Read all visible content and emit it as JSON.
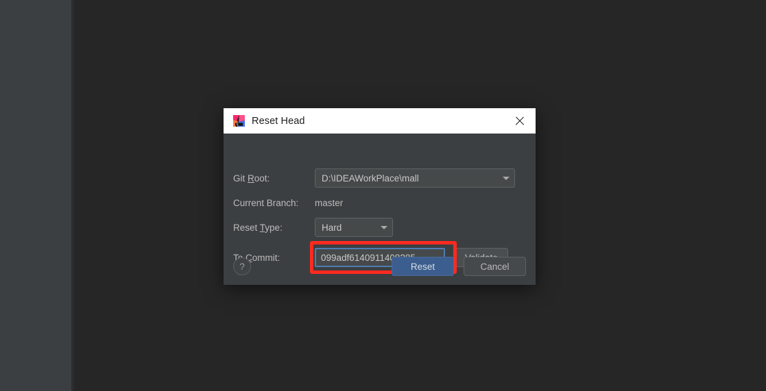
{
  "dialog": {
    "title": "Reset Head",
    "app_icon": "intellij-idea-logo-icon",
    "close_icon": "close-icon",
    "fields": {
      "git_root": {
        "label_before": "Git ",
        "label_mnemonic": "R",
        "label_after": "oot:",
        "value": "D:\\IDEAWorkPlace\\mall",
        "dropdown_icon": "chevron-down-icon"
      },
      "current_branch": {
        "label": "Current Branch:",
        "value": "master"
      },
      "reset_type": {
        "label_before": "Reset ",
        "label_mnemonic": "T",
        "label_after": "ype:",
        "value": "Hard",
        "dropdown_icon": "chevron-down-icon"
      },
      "to_commit": {
        "label_before": "To ",
        "label_mnemonic": "C",
        "label_after": "ommit:",
        "value": "099adf6140911408285",
        "placeholder": ""
      }
    },
    "buttons": {
      "validate_before": "",
      "validate_mnemonic": "V",
      "validate_after": "alidate",
      "help": "?",
      "reset": "Reset",
      "cancel": "Cancel"
    },
    "colors": {
      "highlight_border": "#ff2a20",
      "focus_border": "#4f7cb3",
      "primary_button": "#3c5e8e",
      "dialog_background": "#3c3f41",
      "titlebar_background": "#ffffff",
      "ide_background": "#262626",
      "ide_panel": "#3c3f41"
    }
  }
}
